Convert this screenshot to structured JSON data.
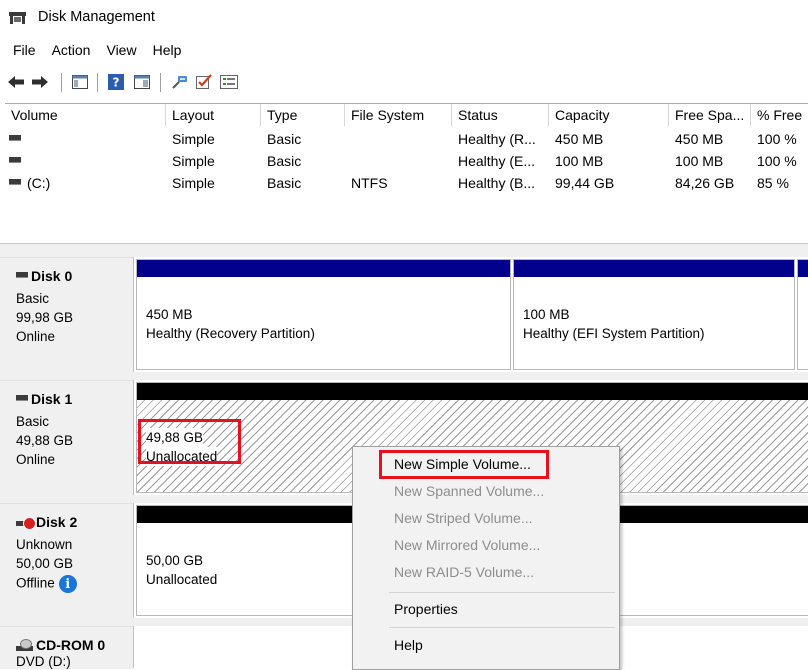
{
  "window": {
    "title": "Disk Management"
  },
  "menu": [
    "File",
    "Action",
    "View",
    "Help"
  ],
  "toolbar": [
    {
      "icon": "back-arrow-icon"
    },
    {
      "icon": "forward-arrow-icon"
    },
    {
      "icon": "show-hide-console-tree-icon"
    },
    {
      "icon": "help-icon"
    },
    {
      "icon": "show-hide-action-pane-icon"
    },
    {
      "icon": "connect-icon"
    },
    {
      "icon": "checkmark-icon"
    },
    {
      "icon": "properties-list-icon"
    }
  ],
  "volume_list": {
    "columns": [
      "Volume",
      "Layout",
      "Type",
      "File System",
      "Status",
      "Capacity",
      "Free Spa...",
      "% Free"
    ],
    "rows": [
      {
        "volume": "",
        "layout": "Simple",
        "type": "Basic",
        "fs": "",
        "status": "Healthy (R...",
        "capacity": "450 MB",
        "free": "450 MB",
        "pct": "100 %"
      },
      {
        "volume": "",
        "layout": "Simple",
        "type": "Basic",
        "fs": "",
        "status": "Healthy (E...",
        "capacity": "100 MB",
        "free": "100 MB",
        "pct": "100 %"
      },
      {
        "volume": "(C:)",
        "layout": "Simple",
        "type": "Basic",
        "fs": "NTFS",
        "status": "Healthy (B...",
        "capacity": "99,44 GB",
        "free": "84,26 GB",
        "pct": "85 %"
      }
    ]
  },
  "disks": [
    {
      "name": "Disk 0",
      "kind": "Basic",
      "size": "99,98 GB",
      "state": "Online",
      "partitions": [
        {
          "size": "450 MB",
          "status": "Healthy (Recovery Partition)"
        },
        {
          "size": "100 MB",
          "status": "Healthy (EFI System Partition)"
        }
      ]
    },
    {
      "name": "Disk 1",
      "kind": "Basic",
      "size": "49,88 GB",
      "state": "Online",
      "partitions": [
        {
          "size": "49,88 GB",
          "status": "Unallocated"
        }
      ]
    },
    {
      "name": "Disk 2",
      "kind": "Unknown",
      "size": "50,00 GB",
      "state": "Offline",
      "partitions": [
        {
          "size": "50,00 GB",
          "status": "Unallocated"
        }
      ]
    },
    {
      "name": "CD-ROM 0",
      "kind": "DVD (D:)"
    }
  ],
  "context_menu": {
    "items": [
      {
        "label": "New Simple Volume...",
        "enabled": true
      },
      {
        "label": "New Spanned Volume...",
        "enabled": false
      },
      {
        "label": "New Striped Volume...",
        "enabled": false
      },
      {
        "label": "New Mirrored Volume...",
        "enabled": false
      },
      {
        "label": "New RAID-5 Volume...",
        "enabled": false
      },
      {
        "label": "Properties",
        "enabled": true
      },
      {
        "label": "Help",
        "enabled": true
      }
    ]
  },
  "colors": {
    "primary_partition_bar": "#00008b",
    "unallocated_bar": "#000000",
    "highlight": "#e8101a"
  }
}
